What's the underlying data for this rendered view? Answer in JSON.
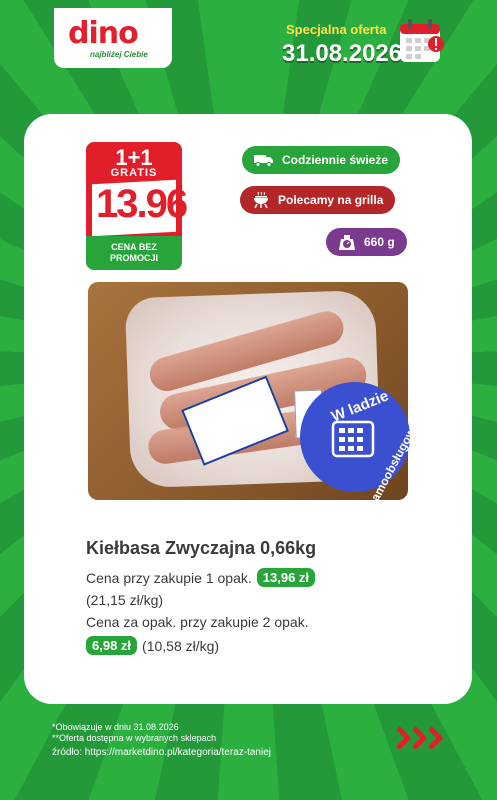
{
  "header": {
    "logo": "dino",
    "tagline": "najbliżej Ciebie",
    "offer_label": "Specjalna oferta",
    "offer_date": "31.08.2026"
  },
  "badge": {
    "promo": "1+1",
    "gratis": "GRATIS",
    "price": "13.96",
    "note_line1": "CENA BEZ",
    "note_line2": "PROMOCJI"
  },
  "tags": {
    "fresh": "Codziennie świeże",
    "grill": "Polecamy na grilla",
    "weight": "660 g"
  },
  "self_service": {
    "line1": "W ladzie",
    "line2": "samoobsługowej"
  },
  "product": {
    "title": "Kiełbasa Zwyczajna 0,66kg",
    "price_label_1": "Cena przy zakupie 1 opak.",
    "price_1": "13,96 zł",
    "unit_price_1": "(21,15 zł/kg)",
    "price_label_2": "Cena za opak. przy zakupie 2 opak.",
    "price_2": "6,98 zł",
    "unit_price_2": "(10,58 zł/kg)"
  },
  "footer": {
    "note1": "*Obowiązuje w dniu 31.08.2026",
    "note2": "**Oferta dostępna w wybranych sklepach",
    "source": "źródło: https://marketdino.pl/kategoria/teraz-taniej"
  },
  "colors": {
    "green": "#27a53a",
    "red": "#e01f2a",
    "purple": "#7a3b8f",
    "blue": "#3b4fd1"
  }
}
